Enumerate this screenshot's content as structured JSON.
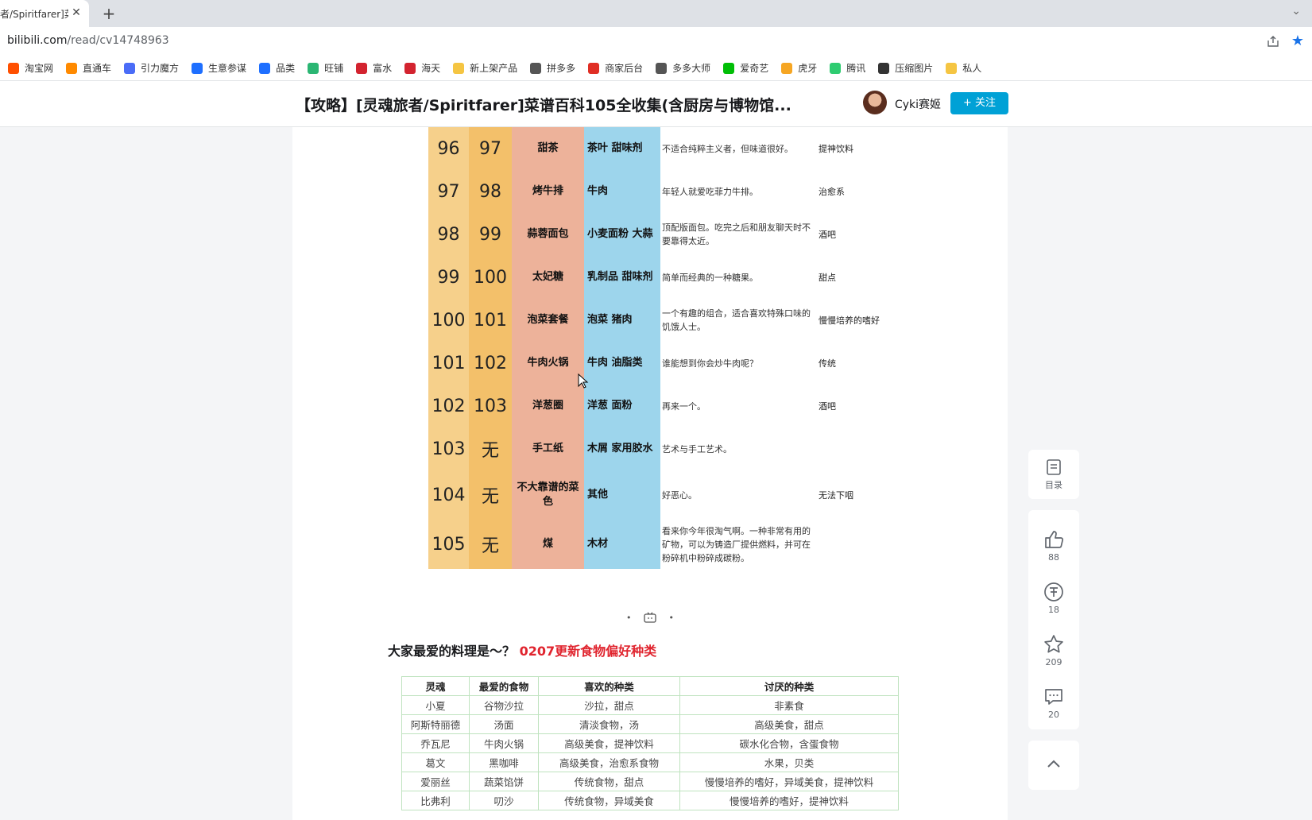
{
  "browser": {
    "tab_title": "者/Spiritfarer]菜",
    "url_host": "bilibili.com",
    "url_path": "/read/cv14748963"
  },
  "bookmarks": [
    {
      "label": "淘宝网",
      "color": "#ff5000"
    },
    {
      "label": "直通车",
      "color": "#ff8a00"
    },
    {
      "label": "引力魔方",
      "color": "#4a6cf7"
    },
    {
      "label": "生意参谋",
      "color": "#1e6fff"
    },
    {
      "label": "品类",
      "color": "#1e6fff"
    },
    {
      "label": "旺铺",
      "color": "#2bb673"
    },
    {
      "label": "富水",
      "color": "#d3232f"
    },
    {
      "label": "海天",
      "color": "#d3232f"
    },
    {
      "label": "新上架产品",
      "color": "#f5c542"
    },
    {
      "label": "拼多多",
      "color": "#555555"
    },
    {
      "label": "商家后台",
      "color": "#e02e24"
    },
    {
      "label": "多多大师",
      "color": "#555555"
    },
    {
      "label": "爱奇艺",
      "color": "#00be06"
    },
    {
      "label": "虎牙",
      "color": "#f6a623"
    },
    {
      "label": "腾讯",
      "color": "#2ecc71"
    },
    {
      "label": "压缩图片",
      "color": "#333333"
    },
    {
      "label": "私人",
      "color": "#f5c542"
    }
  ],
  "article": {
    "title": "【攻略】[灵魂旅者/Spiritfarer]菜谱百科105全收集(含厨房与博物馆...",
    "author": "Cyki赛姬",
    "follow": "+ 关注"
  },
  "recipes": [
    {
      "n1": "96",
      "n2": "97",
      "name": "甜茶",
      "ing": "茶叶 甜味剂",
      "desc": "不适合纯粹主义者，但味道很好。",
      "tag": "提神饮料"
    },
    {
      "n1": "97",
      "n2": "98",
      "name": "烤牛排",
      "ing": "牛肉",
      "desc": "年轻人就爱吃菲力牛排。",
      "tag": "治愈系"
    },
    {
      "n1": "98",
      "n2": "99",
      "name": "蒜蓉面包",
      "ing": "小麦面粉 大蒜",
      "desc": "顶配版面包。吃完之后和朋友聊天时不要靠得太近。",
      "tag": "酒吧"
    },
    {
      "n1": "99",
      "n2": "100",
      "name": "太妃糖",
      "ing": "乳制品 甜味剂",
      "desc": "简单而经典的一种糖果。",
      "tag": "甜点"
    },
    {
      "n1": "100",
      "n2": "101",
      "name": "泡菜套餐",
      "ing": "泡菜 猪肉",
      "desc": "一个有趣的组合，适合喜欢特殊口味的饥饿人士。",
      "tag": "慢慢培养的嗜好"
    },
    {
      "n1": "101",
      "n2": "102",
      "name": "牛肉火锅",
      "ing": "牛肉 油脂类",
      "desc": "谁能想到你会炒牛肉呢？",
      "tag": "传统"
    },
    {
      "n1": "102",
      "n2": "103",
      "name": "洋葱圈",
      "ing": "洋葱 面粉",
      "desc": "再来一个。",
      "tag": "酒吧"
    },
    {
      "n1": "103",
      "n2": "无",
      "name": "手工纸",
      "ing": "木屑 家用胶水",
      "desc": "艺术与手工艺术。",
      "tag": ""
    },
    {
      "n1": "104",
      "n2": "无",
      "name": "不大靠谱的菜色",
      "ing": "其他",
      "desc": "好恶心。",
      "tag": "无法下咽"
    },
    {
      "n1": "105",
      "n2": "无",
      "name": "煤",
      "ing": "木材",
      "desc": "看来你今年很淘气啊。一种非常有用的矿物，可以为铸造厂提供燃料，并可在粉碎机中粉碎成碳粉。",
      "tag": ""
    }
  ],
  "section": {
    "heading": "大家最爱的料理是～？ ",
    "heading_red": "0207更新食物偏好种类"
  },
  "pref_headers": [
    "灵魂",
    "最爱的食物",
    "喜欢的种类",
    "讨厌的种类"
  ],
  "prefs": [
    [
      "小夏",
      "谷物沙拉",
      "沙拉，甜点",
      "非素食"
    ],
    [
      "阿斯特丽德",
      "汤面",
      "清淡食物，汤",
      "高级美食，甜点"
    ],
    [
      "乔瓦尼",
      "牛肉火锅",
      "高级美食，提神饮料",
      "碳水化合物，含蛋食物"
    ],
    [
      "葛文",
      "黑咖啡",
      "高级美食，治愈系食物",
      "水果，贝类"
    ],
    [
      "爱丽丝",
      "蔬菜馅饼",
      "传统食物，甜点",
      "慢慢培养的嗜好，异域美食，提神饮料"
    ],
    [
      "比弗利",
      "叨沙",
      "传统食物，异域美食",
      "慢慢培养的嗜好，提神饮料"
    ]
  ],
  "sidebar": {
    "toc": "目录",
    "likes": "88",
    "coins": "18",
    "favs": "209",
    "comments": "20"
  }
}
